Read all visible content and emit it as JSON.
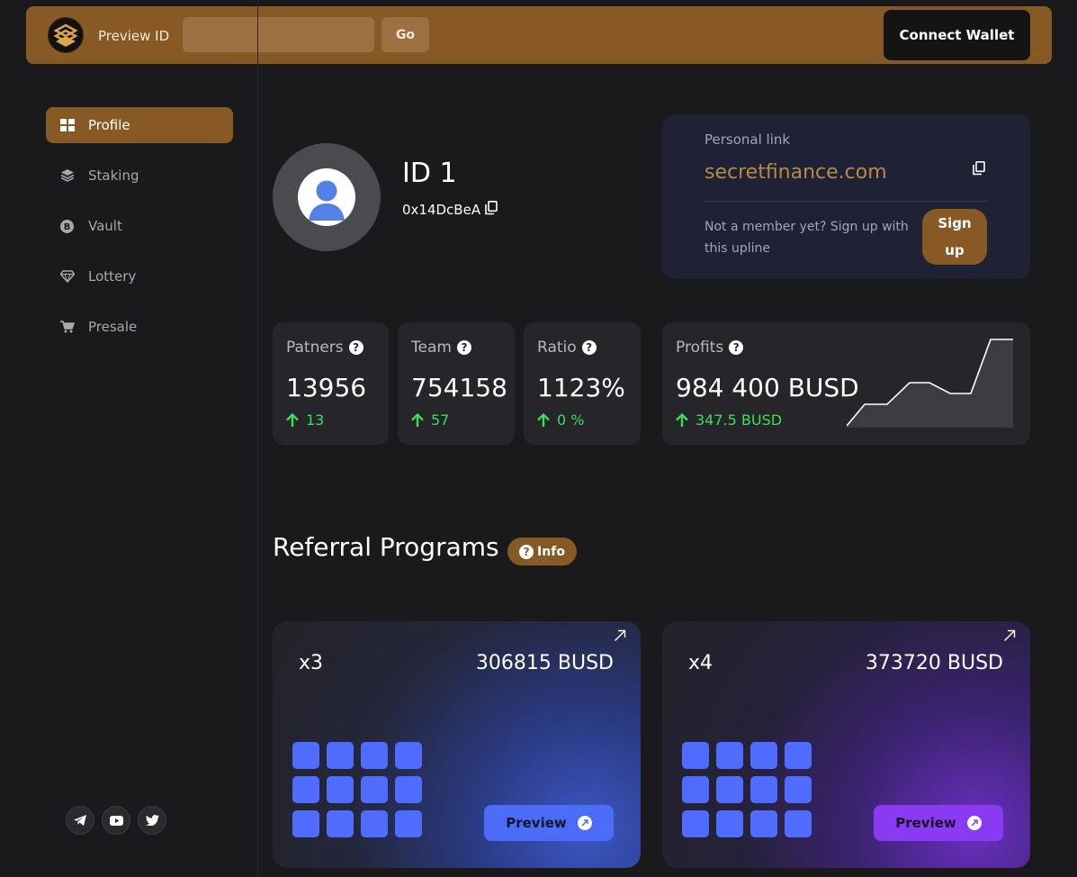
{
  "colors": {
    "accent": "#875a25",
    "background": "#1a1a1c",
    "positive": "#3ddc5a",
    "link": "#b88a45",
    "blue_program": "#4f6cff",
    "purple_program": "#8a3bf2"
  },
  "header": {
    "preview_label": "Preview ID",
    "preview_input_value": "",
    "go_label": "Go",
    "connect_label": "Connect Wallet",
    "logo_icon": "secret-finance-logo-icon"
  },
  "sidebar": {
    "items": [
      {
        "label": "Profile",
        "icon": "grid-icon",
        "active": true
      },
      {
        "label": "Staking",
        "icon": "layers-icon",
        "active": false
      },
      {
        "label": "Vault",
        "icon": "bitcoin-icon",
        "active": false
      },
      {
        "label": "Lottery",
        "icon": "diamond-icon",
        "active": false
      },
      {
        "label": "Presale",
        "icon": "cart-icon",
        "active": false
      }
    ],
    "socials": [
      "telegram-icon",
      "youtube-icon",
      "twitter-icon"
    ]
  },
  "profile": {
    "id_label": "ID 1",
    "address": "0x14DcBeA"
  },
  "personal_link": {
    "label": "Personal link",
    "value": "secretfinance.com",
    "note": "Not a member yet? Sign up with this upline",
    "signup_label": "Sign up"
  },
  "stats": [
    {
      "label": "Patners",
      "value": "13956",
      "delta": "13"
    },
    {
      "label": "Team",
      "value": "754158",
      "delta": "57"
    },
    {
      "label": "Ratio",
      "value": "1123%",
      "delta": "0 %"
    }
  ],
  "profits": {
    "label": "Profits",
    "value": "984 400 BUSD",
    "delta": "347.5 BUSD"
  },
  "chart_data": {
    "type": "area",
    "values": [
      0,
      2,
      2,
      4,
      4,
      3,
      3,
      8,
      8
    ]
  },
  "referral": {
    "title": "Referral Programs",
    "info_label": "Info",
    "programs": [
      {
        "multiplier": "x3",
        "amount": "306815 BUSD",
        "preview_label": "Preview",
        "slots": 12
      },
      {
        "multiplier": "x4",
        "amount": "373720 BUSD",
        "preview_label": "Preview",
        "slots": 12
      }
    ]
  }
}
